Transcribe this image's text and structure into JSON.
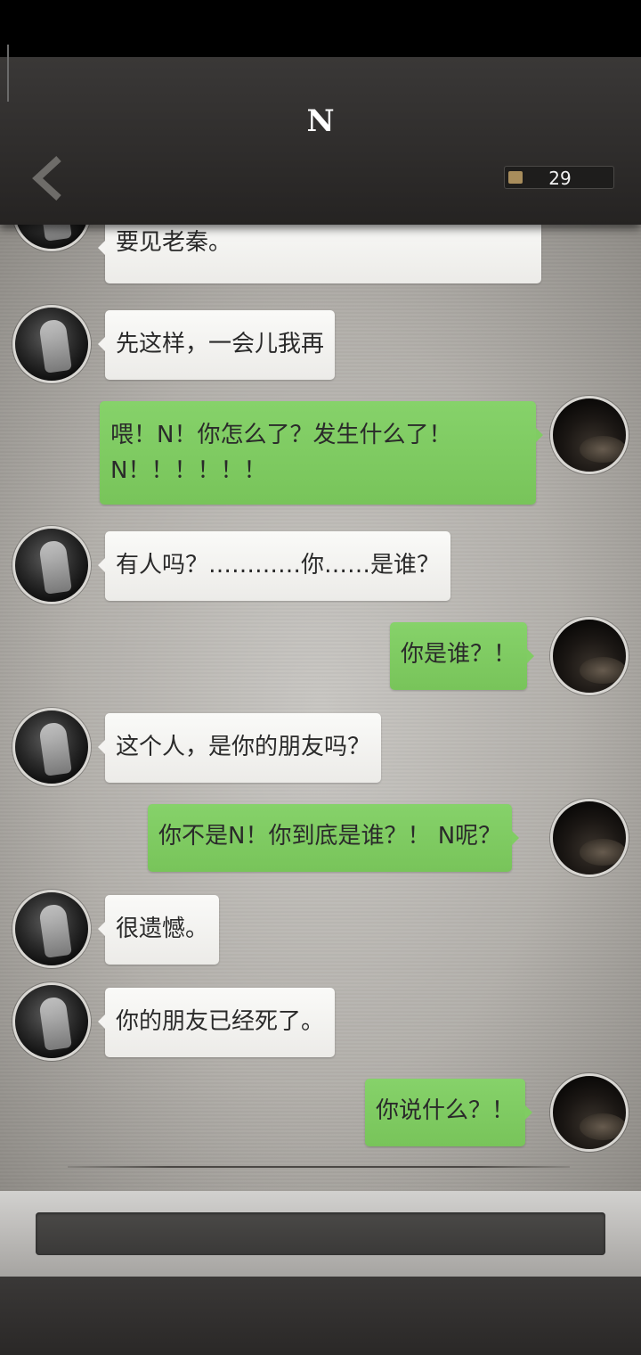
{
  "header": {
    "title": "N",
    "counter_value": "29"
  },
  "messages": [
    {
      "side": "in",
      "text": "要见老秦。"
    },
    {
      "side": "in",
      "text": "先这样，一会儿我再"
    },
    {
      "side": "out",
      "line1": "喂！N！你怎么了？发生什么了！",
      "line2": "N！！！！！！"
    },
    {
      "side": "in",
      "text": "有人吗？…………你……是谁？"
    },
    {
      "side": "out",
      "text": "你是谁？！"
    },
    {
      "side": "in",
      "text": "这个人，是你的朋友吗？"
    },
    {
      "side": "out",
      "text": "你不是N！你到底是谁？！ N呢？"
    },
    {
      "side": "in",
      "text": "很遗憾。"
    },
    {
      "side": "in",
      "text": "你的朋友已经死了。"
    },
    {
      "side": "out",
      "text": "你说什么？！"
    }
  ],
  "colors": {
    "header": "#2e2c2b",
    "bubble_in": "#f4f3f1",
    "bubble_out": "#80cc63",
    "counter_chip": "#a88d5c"
  },
  "icons": {
    "back": "chevron-left-icon",
    "counter": "coin-icon"
  }
}
